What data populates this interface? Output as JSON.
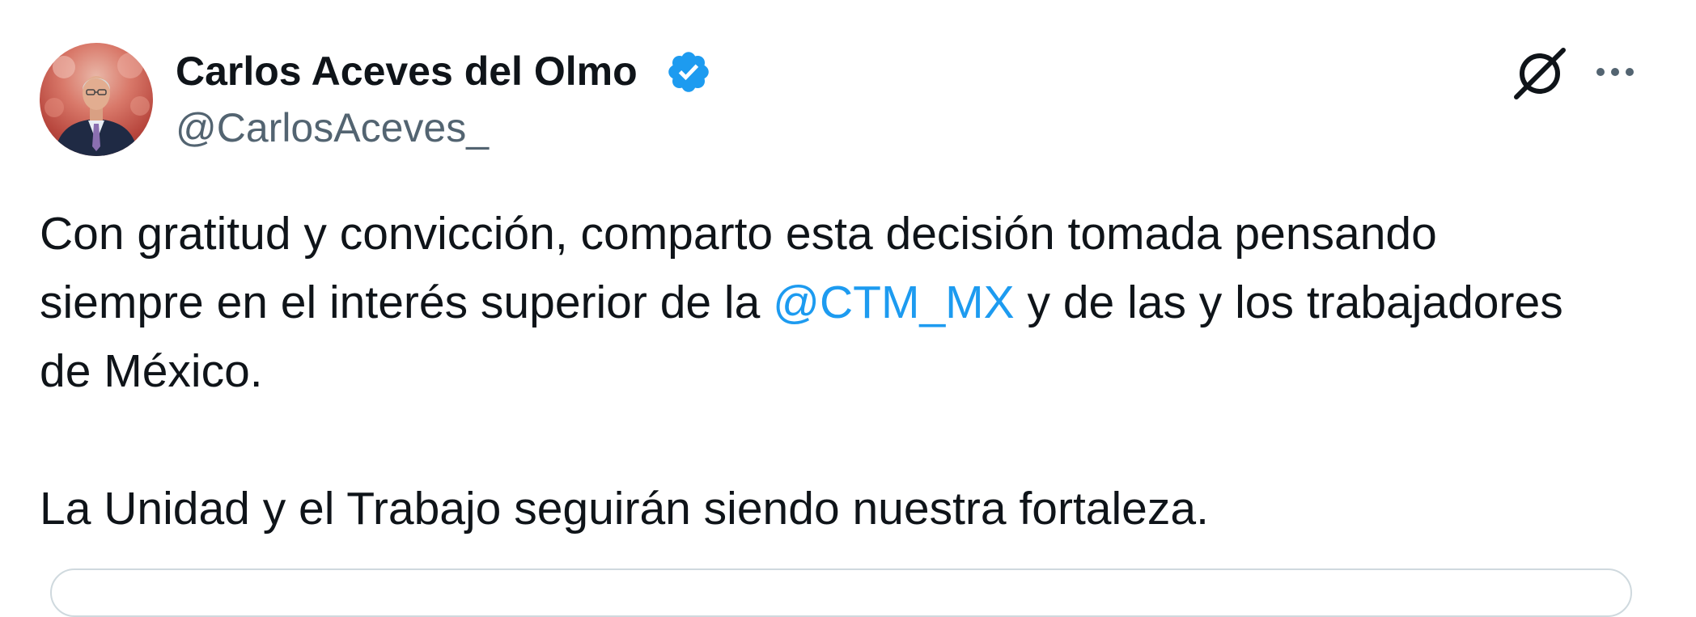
{
  "author": {
    "display_name": "Carlos Aceves del Olmo",
    "handle": "@CarlosAceves_",
    "verified": true,
    "verified_icon": "verified-badge-icon"
  },
  "actions": {
    "grok_icon": "grok-icon",
    "more_icon": "more-horizontal-icon"
  },
  "tweet": {
    "line1": "Con gratitud y convicción, comparto esta decisión tomada pensando",
    "line2_before": "siempre en el interés superior de la ",
    "mention": "@CTM_MX",
    "line2_after": " y de las y los trabajadores",
    "line3": "de México.",
    "line4": "La Unidad y el Trabajo seguirán siendo nuestra fortaleza."
  },
  "colors": {
    "text": "#0f1419",
    "secondary": "#536471",
    "accent": "#1d9bf0",
    "border": "#cfd9de"
  }
}
